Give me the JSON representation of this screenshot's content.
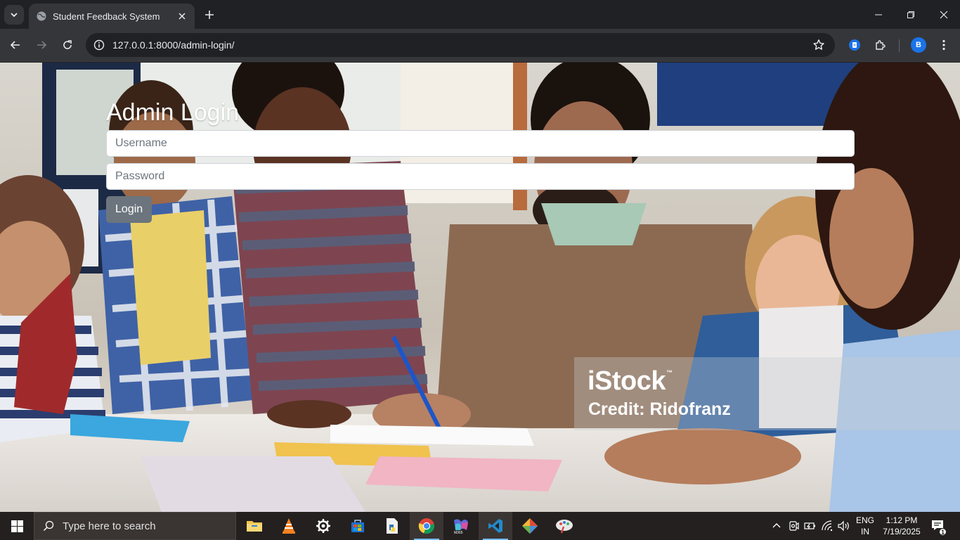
{
  "browser": {
    "tab_title": "Student Feedback System",
    "url_host": "127.0.0.1",
    "url_rest": ":8000/admin-login/",
    "profile_initial": "B"
  },
  "page": {
    "heading": "Admin Login",
    "username_placeholder": "Username",
    "password_placeholder": "Password",
    "login_label": "Login",
    "watermark_brand": "iStock",
    "watermark_tm": "™",
    "watermark_credit": "Credit: Ridofranz"
  },
  "taskbar": {
    "search_placeholder": "Type here to search",
    "language": "ENG",
    "region": "IN",
    "time": "1:12 PM",
    "date": "7/19/2025",
    "notification_count": "1"
  },
  "colors": {
    "login_button": "#6c757d",
    "chrome_dark": "#202124",
    "chrome_toolbar": "#35363a",
    "taskbar": "#23201f"
  }
}
